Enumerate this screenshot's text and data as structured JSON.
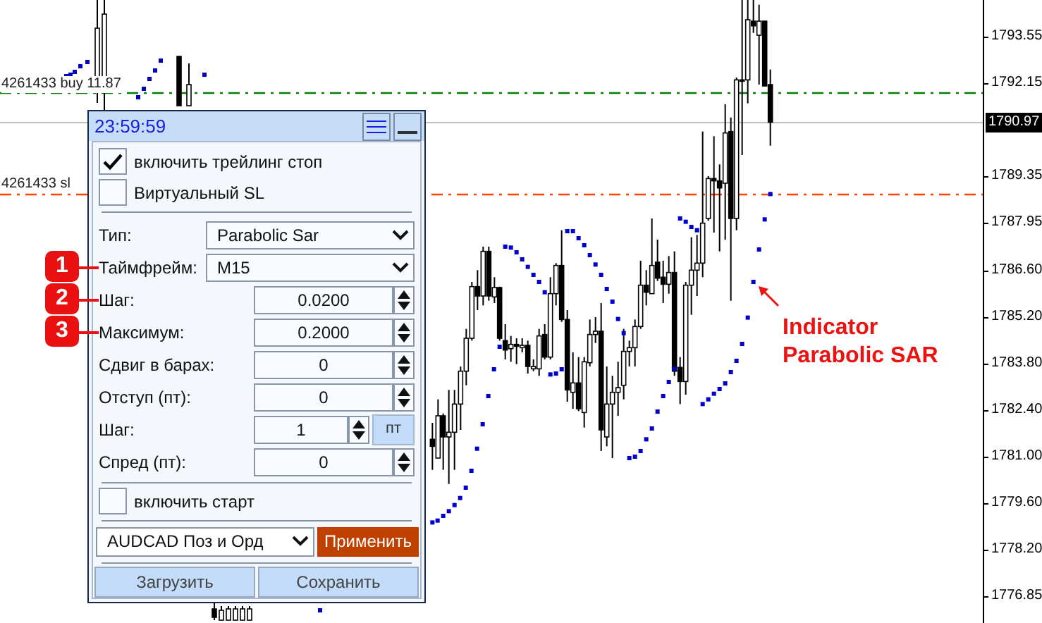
{
  "chart": {
    "order_lines": [
      {
        "kind": "buy",
        "label": "4261433 buy 11.87"
      },
      {
        "kind": "sl",
        "label": "4261433 sl"
      }
    ],
    "current_price": "1790.97",
    "price_axis": [
      "1793.55",
      "1792.15",
      "1789.35",
      "1787.95",
      "1786.60",
      "1785.20",
      "1783.80",
      "1782.40",
      "1781.00",
      "1779.60",
      "1778.20",
      "1776.85"
    ],
    "annotation": "Indicator Parabolic SAR"
  },
  "panel": {
    "time": "23:59:59",
    "options": [
      {
        "label": "включить трейлинг стоп",
        "checked": true
      },
      {
        "label": "Виртуальный SL",
        "checked": false
      }
    ],
    "fields": [
      {
        "kind": "dropdown",
        "label": "Тип:",
        "value": "Parabolic Sar"
      },
      {
        "kind": "dropdown",
        "label": "Таймфрейм:",
        "value": "M15",
        "badge": "1"
      },
      {
        "kind": "spinner",
        "label": "Шаг:",
        "value": "0.0200",
        "badge": "2"
      },
      {
        "kind": "spinner",
        "label": "Максимум:",
        "value": "0.2000",
        "badge": "3"
      },
      {
        "kind": "spinner",
        "label": "Сдвиг в барах:",
        "value": "0"
      },
      {
        "kind": "spinner",
        "label": "Отступ (пт):",
        "value": "0"
      },
      {
        "kind": "spinner_unit",
        "label": "Шаг:",
        "value": "1",
        "unit": "пт"
      },
      {
        "kind": "spinner",
        "label": "Спред (пт):",
        "value": "0"
      }
    ],
    "start": {
      "label": "включить старт",
      "checked": false
    },
    "preset": "AUDCAD Поз и Орд",
    "apply_button": "Применить",
    "buttons": [
      "Загрузить",
      "Сохранить"
    ]
  }
}
